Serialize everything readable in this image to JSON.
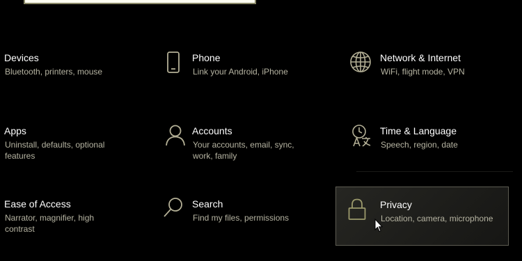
{
  "colors": {
    "background": "#000000",
    "title_text": "#ffffff",
    "description_text": "#b6b4a2",
    "icon_stroke": "#b4b096",
    "privacy_icon": "#9c9a6c",
    "selected_tile_bg": "#1f1f1c",
    "selected_tile_border": "#5d5c52"
  },
  "tiles": [
    {
      "title": "Devices",
      "desc": [
        "Bluetooth, printers, mouse"
      ],
      "icon": "keyboard-icon"
    },
    {
      "title": "Phone",
      "desc": [
        "Link your Android, iPhone"
      ],
      "icon": "phone-icon"
    },
    {
      "title": "Network & Internet",
      "desc": [
        "WiFi, flight mode, VPN"
      ],
      "icon": "globe-icon"
    },
    {
      "title": "Apps",
      "desc": [
        "Uninstall, defaults, optional",
        "features"
      ],
      "icon": "apps-icon"
    },
    {
      "title": "Accounts",
      "desc": [
        "Your accounts, email, sync,",
        "work, family"
      ],
      "icon": "person-icon"
    },
    {
      "title": "Time & Language",
      "desc": [
        "Speech, region, date"
      ],
      "icon": "clock-language-icon"
    },
    {
      "title": "Ease of Access",
      "desc": [
        "Narrator, magnifier, high",
        "contrast"
      ],
      "icon": "ease-of-access-icon"
    },
    {
      "title": "Search",
      "desc": [
        "Find my files, permissions"
      ],
      "icon": "search-icon"
    },
    {
      "title": "Privacy",
      "desc": [
        "Location, camera, microphone"
      ],
      "icon": "lock-icon",
      "selected": true
    }
  ]
}
